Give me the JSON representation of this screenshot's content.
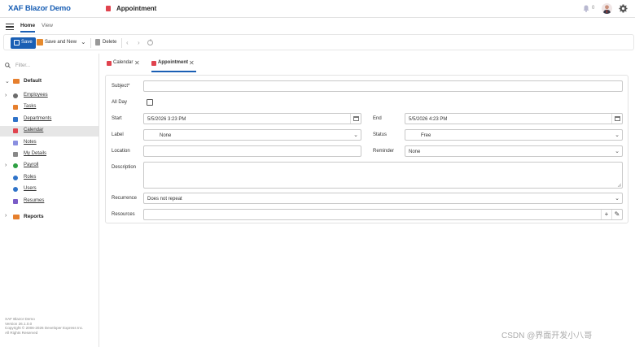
{
  "header": {
    "app_title": "XAF Blazor Demo",
    "view_title": "Appointment",
    "notification_count": "0"
  },
  "ribbon": {
    "tabs": [
      {
        "label": "Home",
        "active": true
      },
      {
        "label": "View",
        "active": false
      }
    ]
  },
  "toolbar": {
    "save_label": "Save",
    "save_and_new_label": "Save and New",
    "delete_label": "Delete"
  },
  "sidebar": {
    "filter_placeholder": "Filter...",
    "groups": [
      {
        "label": "Default",
        "expanded": true,
        "items": [
          {
            "label": "Employees",
            "icon": "person-icon",
            "color": "#6b6b6b",
            "expandable": true
          },
          {
            "label": "Tasks",
            "icon": "tasks-icon",
            "color": "#e67f2d"
          },
          {
            "label": "Departments",
            "icon": "org-icon",
            "color": "#2f73c9"
          },
          {
            "label": "Calendar",
            "icon": "calendar-icon",
            "color": "#e0434e",
            "active": true
          },
          {
            "label": "Notes",
            "icon": "note-icon",
            "color": "#8a8fe0"
          },
          {
            "label": "My Details",
            "icon": "user-card-icon",
            "color": "#888888"
          },
          {
            "label": "Payroll",
            "icon": "money-icon",
            "color": "#2ea043",
            "expandable": true
          },
          {
            "label": "Roles",
            "icon": "roles-icon",
            "color": "#2f73c9"
          },
          {
            "label": "Users",
            "icon": "users-icon",
            "color": "#2f73c9"
          },
          {
            "label": "Resumes",
            "icon": "resume-icon",
            "color": "#7a5cc7"
          }
        ]
      },
      {
        "label": "Reports",
        "expanded": false,
        "items": []
      }
    ],
    "footer": [
      "XAF Blazor Demo",
      "Version 26.1.0.0",
      "Copyright © 2006-2026 Developer Express Inc.",
      "All Rights Reserved"
    ]
  },
  "doc_tabs": [
    {
      "label": "Calendar",
      "active": false
    },
    {
      "label": "Appointment",
      "active": true
    }
  ],
  "form": {
    "subject_label": "Subject*",
    "subject_value": "",
    "allday_label": "All Day",
    "allday_checked": false,
    "start_label": "Start",
    "start_value": "5/5/2026 3:23 PM",
    "end_label": "End",
    "end_value": "5/5/2026 4:23 PM",
    "label_label": "Label",
    "label_value": "None",
    "status_label": "Status",
    "status_value": "Free",
    "location_label": "Location",
    "location_value": "",
    "reminder_label": "Reminder",
    "reminder_value": "None",
    "description_label": "Description",
    "description_value": "",
    "recurrence_label": "Recurrence",
    "recurrence_value": "Does not repeat",
    "resources_label": "Resources",
    "resources_value": ""
  },
  "watermark": "CSDN @界面开发小八哥",
  "colors": {
    "accent": "#1a5fb4",
    "calendar": "#e0434e",
    "folder": "#e67f2d"
  }
}
